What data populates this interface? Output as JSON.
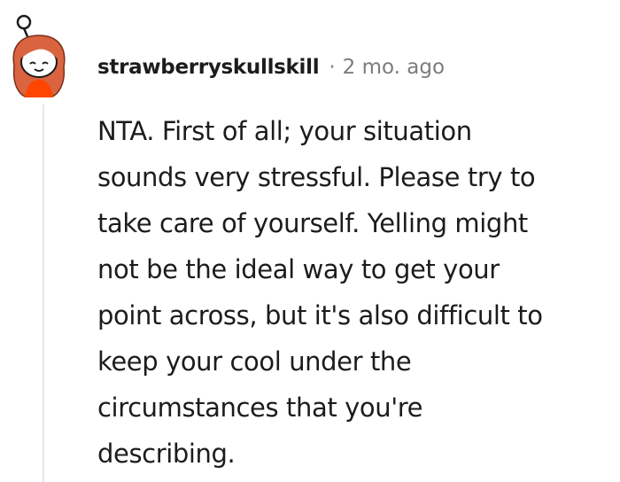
{
  "comment": {
    "author": "strawberryskullskill",
    "separator": "·",
    "timestamp": "2 mo. ago",
    "body": "NTA. First of all; your situation\nsounds very stressful. Please try to\ntake care of yourself. Yelling might\nnot be the ideal way to get your\npoint across, but it's also difficult to\nkeep your cool under the\ncircumstances that you're\ndescribing.",
    "avatar_icon": "snoo-avatar-icon"
  },
  "colors": {
    "text": "#1c1c1c",
    "meta": "#7c7c7c",
    "thread_line": "#e5e8ea",
    "avatar_hair": "#d9643f",
    "avatar_shirt": "#ff4500"
  }
}
